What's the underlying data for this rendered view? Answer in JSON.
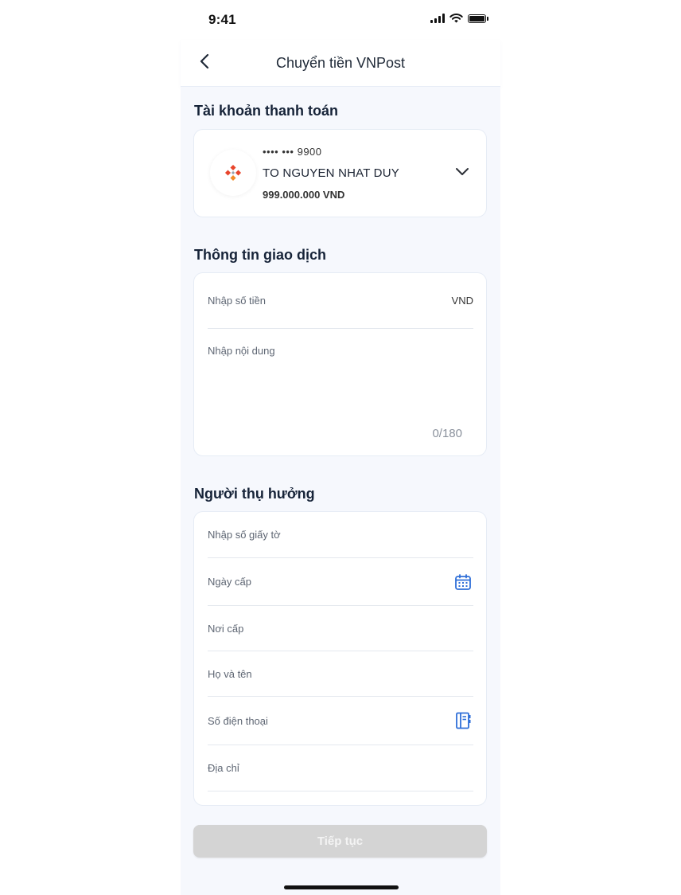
{
  "status_bar": {
    "time": "9:41"
  },
  "header": {
    "title": "Chuyển tiền VNPost"
  },
  "account_section": {
    "title": "Tài khoản thanh toán",
    "masked_number": "•••• ••• 9900",
    "holder_name": "TO NGUYEN NHAT DUY",
    "balance": "999.000.000 VND"
  },
  "transaction_section": {
    "title": "Thông tin giao dịch",
    "amount_placeholder": "Nhập số tiền",
    "currency": "VND",
    "content_placeholder": "Nhập nội dung",
    "char_counter": "0/180"
  },
  "beneficiary_section": {
    "title": "Người thụ hưởng",
    "id_number_placeholder": "Nhập số giấy tờ",
    "issue_date_placeholder": "Ngày cấp",
    "issue_place_placeholder": "Nơi cấp",
    "full_name_placeholder": "Họ và tên",
    "phone_placeholder": "Số điện thoại",
    "address_placeholder": "Địa chỉ"
  },
  "continue_button": {
    "label": "Tiếp tục"
  },
  "colors": {
    "accent": "#2f6fd8",
    "button_disabled": "#d4d4d4",
    "background": "#f6f8fd",
    "logo_red": "#e8452c",
    "logo_orange": "#f28c28"
  },
  "icons": [
    "back-icon",
    "chevron-down-icon",
    "calendar-icon",
    "contacts-book-icon"
  ]
}
